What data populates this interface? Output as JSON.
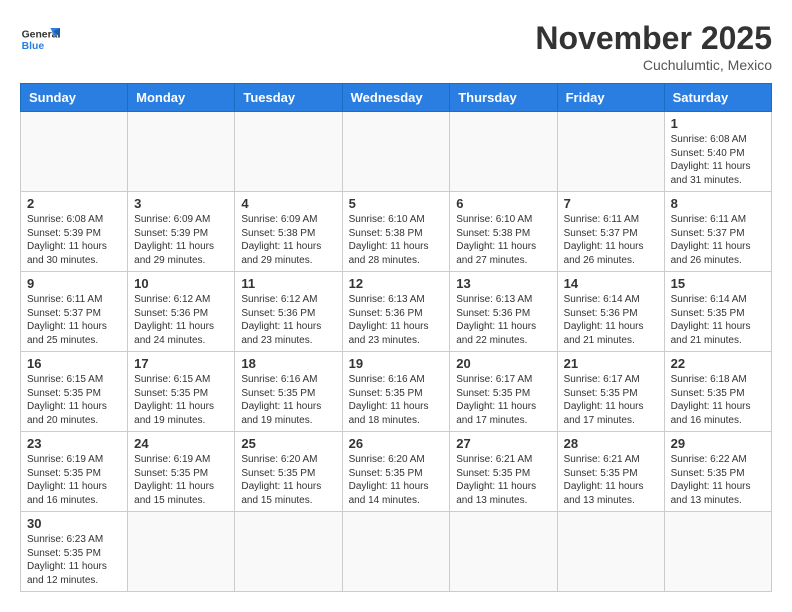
{
  "header": {
    "logo_general": "General",
    "logo_blue": "Blue",
    "month_title": "November 2025",
    "location": "Cuchulumtic, Mexico"
  },
  "days_of_week": [
    "Sunday",
    "Monday",
    "Tuesday",
    "Wednesday",
    "Thursday",
    "Friday",
    "Saturday"
  ],
  "weeks": [
    [
      {
        "num": "",
        "info": ""
      },
      {
        "num": "",
        "info": ""
      },
      {
        "num": "",
        "info": ""
      },
      {
        "num": "",
        "info": ""
      },
      {
        "num": "",
        "info": ""
      },
      {
        "num": "",
        "info": ""
      },
      {
        "num": "1",
        "info": "Sunrise: 6:08 AM\nSunset: 5:40 PM\nDaylight: 11 hours\nand 31 minutes."
      }
    ],
    [
      {
        "num": "2",
        "info": "Sunrise: 6:08 AM\nSunset: 5:39 PM\nDaylight: 11 hours\nand 30 minutes."
      },
      {
        "num": "3",
        "info": "Sunrise: 6:09 AM\nSunset: 5:39 PM\nDaylight: 11 hours\nand 29 minutes."
      },
      {
        "num": "4",
        "info": "Sunrise: 6:09 AM\nSunset: 5:38 PM\nDaylight: 11 hours\nand 29 minutes."
      },
      {
        "num": "5",
        "info": "Sunrise: 6:10 AM\nSunset: 5:38 PM\nDaylight: 11 hours\nand 28 minutes."
      },
      {
        "num": "6",
        "info": "Sunrise: 6:10 AM\nSunset: 5:38 PM\nDaylight: 11 hours\nand 27 minutes."
      },
      {
        "num": "7",
        "info": "Sunrise: 6:11 AM\nSunset: 5:37 PM\nDaylight: 11 hours\nand 26 minutes."
      },
      {
        "num": "8",
        "info": "Sunrise: 6:11 AM\nSunset: 5:37 PM\nDaylight: 11 hours\nand 26 minutes."
      }
    ],
    [
      {
        "num": "9",
        "info": "Sunrise: 6:11 AM\nSunset: 5:37 PM\nDaylight: 11 hours\nand 25 minutes."
      },
      {
        "num": "10",
        "info": "Sunrise: 6:12 AM\nSunset: 5:36 PM\nDaylight: 11 hours\nand 24 minutes."
      },
      {
        "num": "11",
        "info": "Sunrise: 6:12 AM\nSunset: 5:36 PM\nDaylight: 11 hours\nand 23 minutes."
      },
      {
        "num": "12",
        "info": "Sunrise: 6:13 AM\nSunset: 5:36 PM\nDaylight: 11 hours\nand 23 minutes."
      },
      {
        "num": "13",
        "info": "Sunrise: 6:13 AM\nSunset: 5:36 PM\nDaylight: 11 hours\nand 22 minutes."
      },
      {
        "num": "14",
        "info": "Sunrise: 6:14 AM\nSunset: 5:36 PM\nDaylight: 11 hours\nand 21 minutes."
      },
      {
        "num": "15",
        "info": "Sunrise: 6:14 AM\nSunset: 5:35 PM\nDaylight: 11 hours\nand 21 minutes."
      }
    ],
    [
      {
        "num": "16",
        "info": "Sunrise: 6:15 AM\nSunset: 5:35 PM\nDaylight: 11 hours\nand 20 minutes."
      },
      {
        "num": "17",
        "info": "Sunrise: 6:15 AM\nSunset: 5:35 PM\nDaylight: 11 hours\nand 19 minutes."
      },
      {
        "num": "18",
        "info": "Sunrise: 6:16 AM\nSunset: 5:35 PM\nDaylight: 11 hours\nand 19 minutes."
      },
      {
        "num": "19",
        "info": "Sunrise: 6:16 AM\nSunset: 5:35 PM\nDaylight: 11 hours\nand 18 minutes."
      },
      {
        "num": "20",
        "info": "Sunrise: 6:17 AM\nSunset: 5:35 PM\nDaylight: 11 hours\nand 17 minutes."
      },
      {
        "num": "21",
        "info": "Sunrise: 6:17 AM\nSunset: 5:35 PM\nDaylight: 11 hours\nand 17 minutes."
      },
      {
        "num": "22",
        "info": "Sunrise: 6:18 AM\nSunset: 5:35 PM\nDaylight: 11 hours\nand 16 minutes."
      }
    ],
    [
      {
        "num": "23",
        "info": "Sunrise: 6:19 AM\nSunset: 5:35 PM\nDaylight: 11 hours\nand 16 minutes."
      },
      {
        "num": "24",
        "info": "Sunrise: 6:19 AM\nSunset: 5:35 PM\nDaylight: 11 hours\nand 15 minutes."
      },
      {
        "num": "25",
        "info": "Sunrise: 6:20 AM\nSunset: 5:35 PM\nDaylight: 11 hours\nand 15 minutes."
      },
      {
        "num": "26",
        "info": "Sunrise: 6:20 AM\nSunset: 5:35 PM\nDaylight: 11 hours\nand 14 minutes."
      },
      {
        "num": "27",
        "info": "Sunrise: 6:21 AM\nSunset: 5:35 PM\nDaylight: 11 hours\nand 13 minutes."
      },
      {
        "num": "28",
        "info": "Sunrise: 6:21 AM\nSunset: 5:35 PM\nDaylight: 11 hours\nand 13 minutes."
      },
      {
        "num": "29",
        "info": "Sunrise: 6:22 AM\nSunset: 5:35 PM\nDaylight: 11 hours\nand 13 minutes."
      }
    ],
    [
      {
        "num": "30",
        "info": "Sunrise: 6:23 AM\nSunset: 5:35 PM\nDaylight: 11 hours\nand 12 minutes."
      },
      {
        "num": "",
        "info": ""
      },
      {
        "num": "",
        "info": ""
      },
      {
        "num": "",
        "info": ""
      },
      {
        "num": "",
        "info": ""
      },
      {
        "num": "",
        "info": ""
      },
      {
        "num": "",
        "info": ""
      }
    ]
  ]
}
